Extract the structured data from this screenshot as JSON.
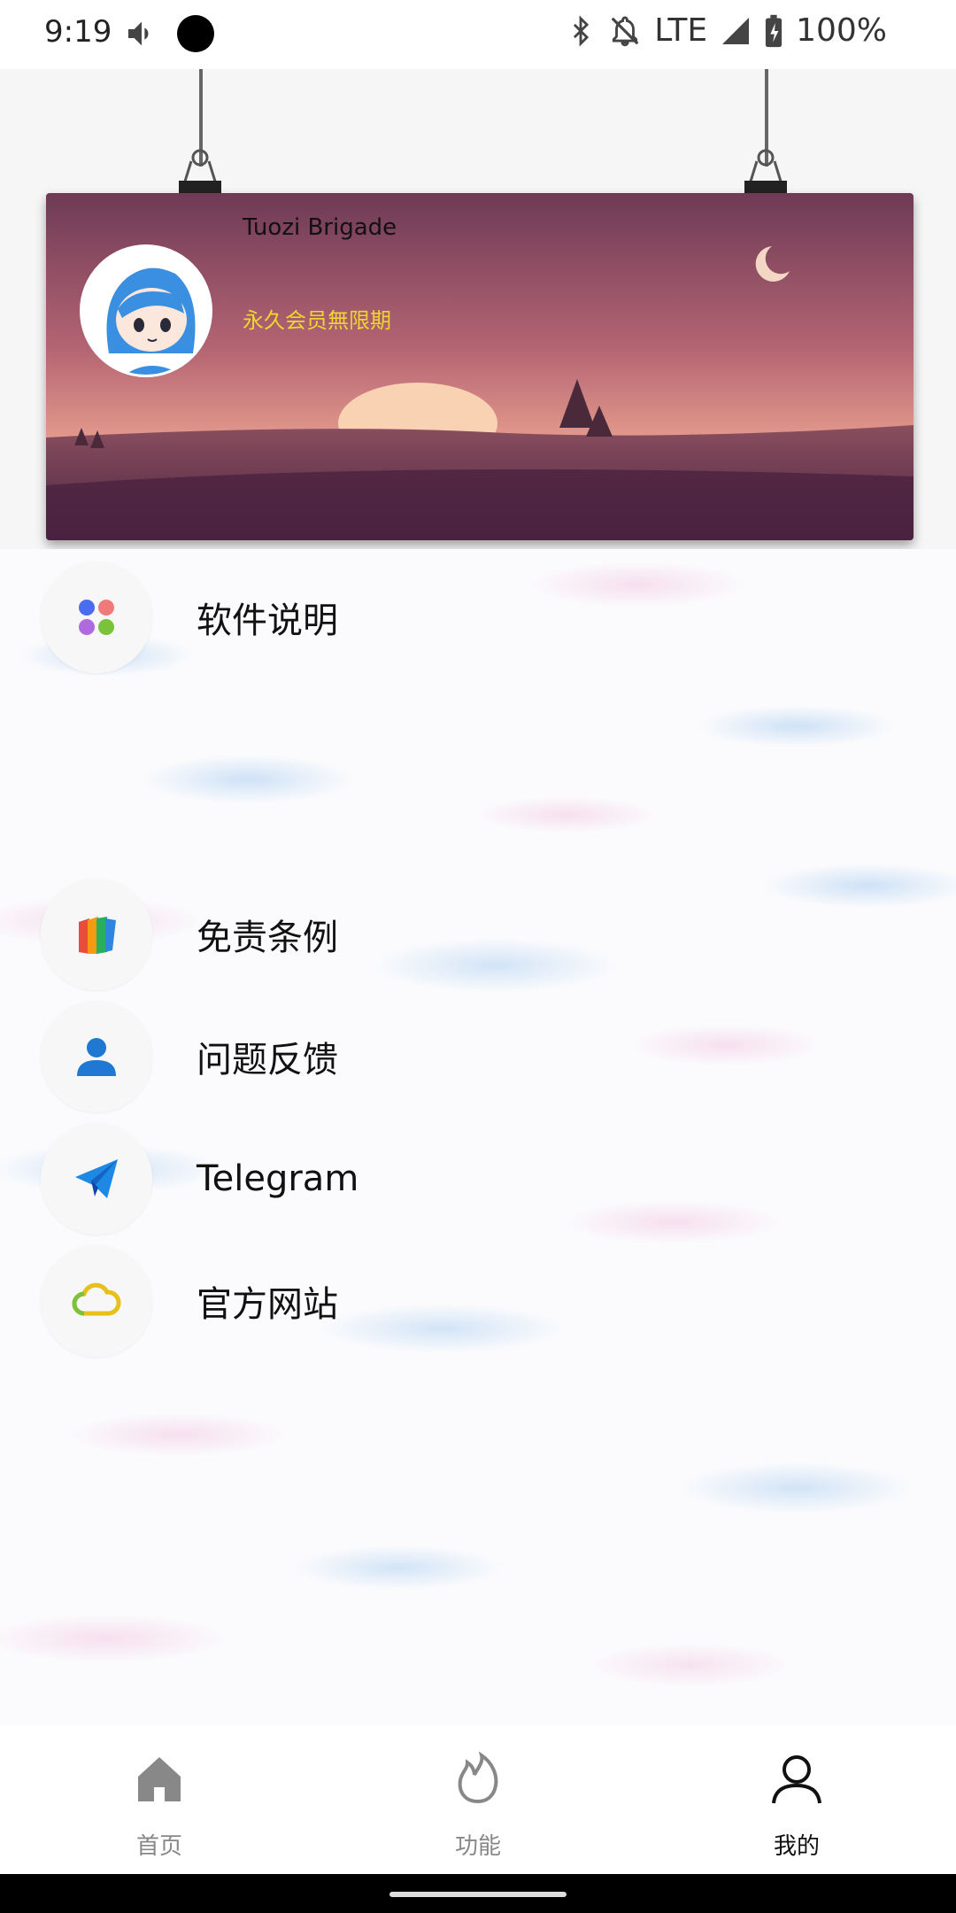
{
  "status_bar": {
    "time": "9:19",
    "network": "LTE",
    "battery": "100%"
  },
  "profile": {
    "user_name": "Tuozi Brigade",
    "membership": "永久会员無限期"
  },
  "menu": {
    "items": [
      {
        "label": "软件说明",
        "icon": "dots-icon"
      },
      {
        "label": "免责条例",
        "icon": "book-icon"
      },
      {
        "label": "问题反馈",
        "icon": "person-icon"
      },
      {
        "label": "Telegram",
        "icon": "paper-plane-icon"
      },
      {
        "label": "官方网站",
        "icon": "cloud-icon"
      }
    ]
  },
  "bottom_nav": {
    "items": [
      {
        "label": "首页",
        "icon": "home-icon",
        "active": false
      },
      {
        "label": "功能",
        "icon": "flame-icon",
        "active": false
      },
      {
        "label": "我的",
        "icon": "profile-icon",
        "active": true
      }
    ]
  },
  "colors": {
    "membership_text": "#f0d430",
    "nav_active": "#111111",
    "nav_inactive": "#888888"
  }
}
